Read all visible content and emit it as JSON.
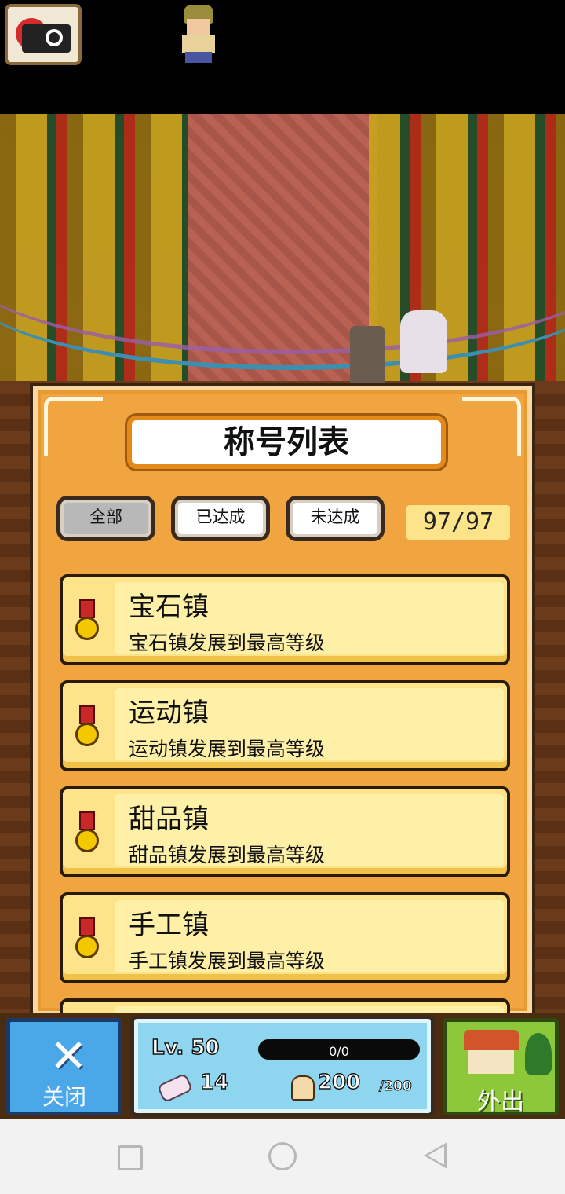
{
  "panel": {
    "title": "称号列表",
    "filters": [
      {
        "label": "全部",
        "active": true
      },
      {
        "label": "已达成",
        "active": false
      },
      {
        "label": "未达成",
        "active": false
      }
    ],
    "counter": "97/97"
  },
  "titles": [
    {
      "name": "宝石镇",
      "desc": "宝石镇发展到最高等级",
      "icon": "medal-icon"
    },
    {
      "name": "运动镇",
      "desc": "运动镇发展到最高等级",
      "icon": "medal-icon"
    },
    {
      "name": "甜品镇",
      "desc": "甜品镇发展到最高等级",
      "icon": "medal-icon"
    },
    {
      "name": "手工镇",
      "desc": "手工镇发展到最高等级",
      "icon": "medal-icon"
    }
  ],
  "bottom": {
    "close_label": "关闭",
    "level": "Lv. 50",
    "exp": "0/0",
    "points": "14",
    "stamina": "200",
    "stamina_max": "/200",
    "go_out_label": "外出"
  },
  "colors": {
    "panel": "#f0a540",
    "item_bg": "#fde48a",
    "close_button": "#4aa8e8",
    "go_out_button": "#8cc83a",
    "status_panel": "#8ed6f0"
  }
}
